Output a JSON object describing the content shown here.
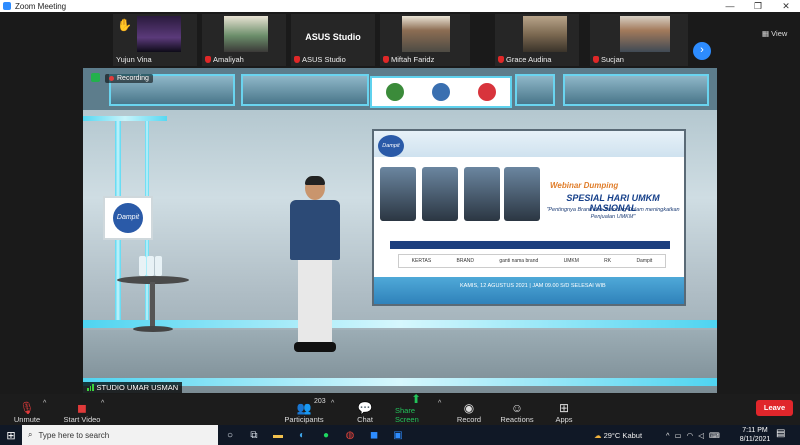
{
  "window": {
    "title": "Zoom Meeting",
    "minimize": "—",
    "maximize": "❐",
    "close": "✕"
  },
  "participants_strip": [
    {
      "name": "Yujun Vina",
      "raised_hand": true,
      "muted": false
    },
    {
      "name": "Amaliyah",
      "raised_hand": false,
      "muted": true
    },
    {
      "name": "ASUS Studio",
      "raised_hand": false,
      "muted": true,
      "video_label": "ASUS Studio"
    },
    {
      "name": "Miftah Faridz",
      "raised_hand": false,
      "muted": true
    },
    {
      "name": "Grace Audina",
      "raised_hand": false,
      "muted": true
    },
    {
      "name": "Sucjan",
      "raised_hand": false,
      "muted": true
    }
  ],
  "strip_controls": {
    "next_icon": "chevron-right-icon",
    "view_label": "View"
  },
  "main_video": {
    "recording_label": "Recording",
    "speaker_name": "STUDIO UMAR USMAN",
    "standee_text": "Dampit",
    "slide": {
      "logo_text": "Dampit",
      "script_title": "Webinar Dumping",
      "main_title": "SPESIAL HARI UMKM NASIONAL",
      "subtitle": "\"Pentingnya Brand dan Branding Dalam meningkatkan Penjualan UMKM\"",
      "date_line": "KAMIS, 12 AGUSTUS 2021 | JAM 09.00 S/D SELESAI WIB",
      "sponsor_logos": [
        "KERTAS",
        "BRAND",
        "ganti nama brand",
        "UMKM",
        "RK",
        "Dampit"
      ]
    }
  },
  "toolbar": {
    "unmute_label": "Unmute",
    "start_video_label": "Start Video",
    "participants_label": "Participants",
    "participants_count": "203",
    "chat_label": "Chat",
    "share_screen_label": "Share Screen",
    "record_label": "Record",
    "reactions_label": "Reactions",
    "apps_label": "Apps",
    "leave_label": "Leave"
  },
  "taskbar": {
    "search_placeholder": "Type here to search",
    "weather": "29°C  Kabut",
    "time": "7:11 PM",
    "date": "8/11/2021"
  },
  "colors": {
    "zoom_blue": "#2d8cff",
    "leave_red": "#e0262b",
    "share_green": "#23c35a",
    "stage_glow": "#4fd4f1"
  }
}
